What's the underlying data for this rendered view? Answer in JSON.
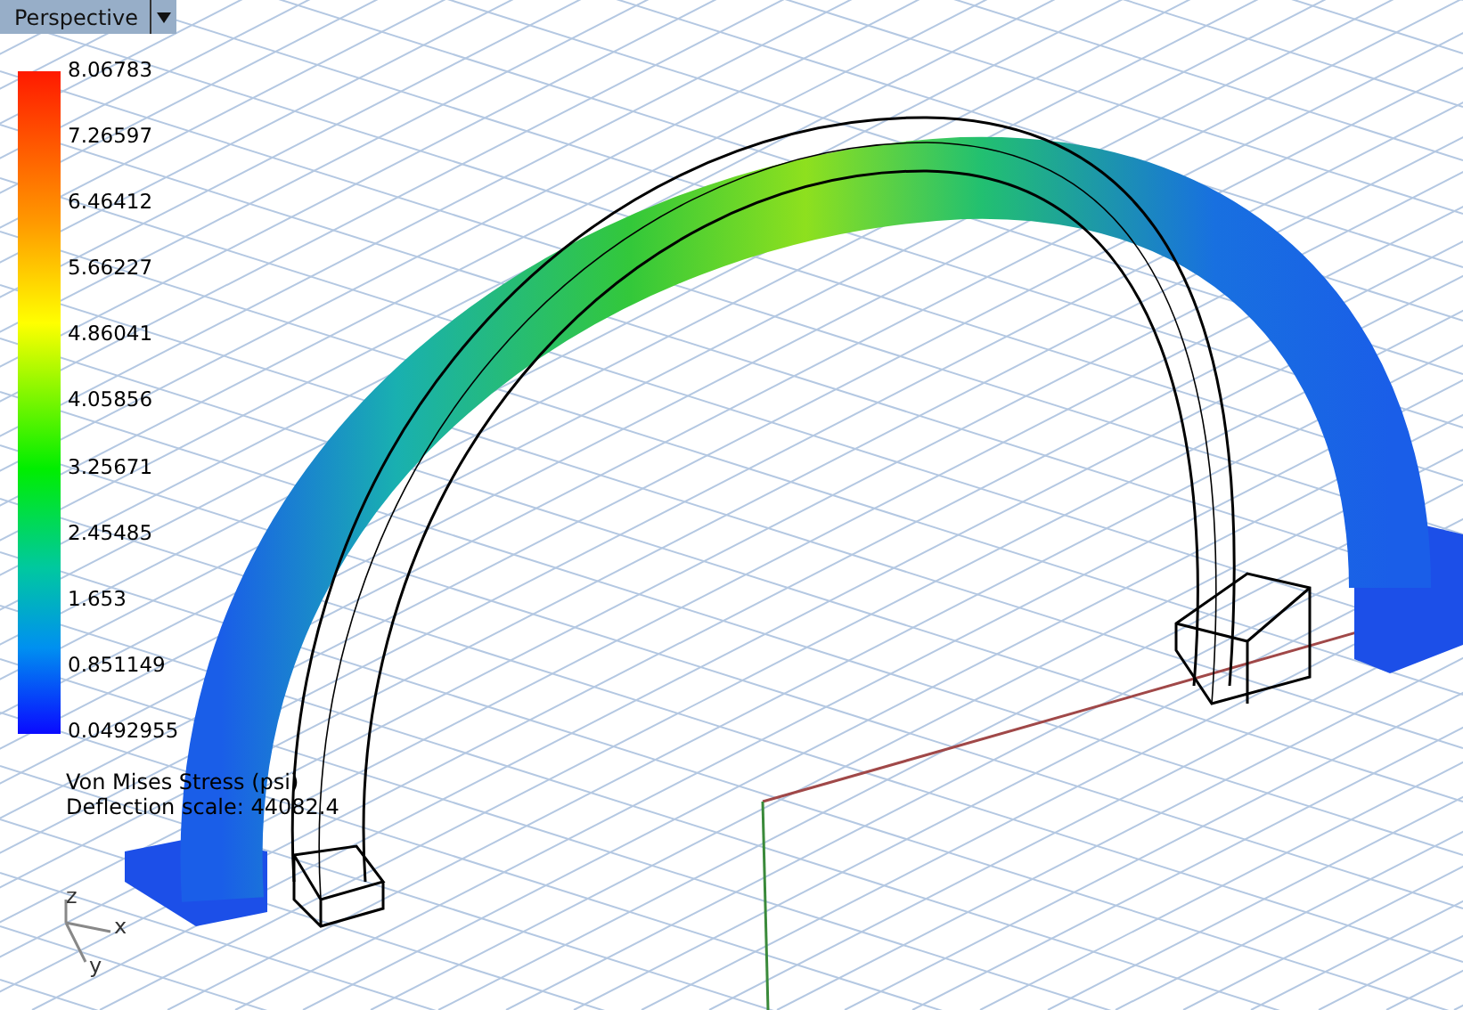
{
  "viewport": {
    "title": "Perspective"
  },
  "legend": {
    "ticks": [
      "8.06783",
      "7.26597",
      "6.46412",
      "5.66227",
      "4.86041",
      "4.05856",
      "3.25671",
      "2.45485",
      "1.653",
      "0.851149",
      "0.0492955"
    ]
  },
  "caption": [
    "Von Mises Stress (psi)",
    "Deflection scale: 44082.4"
  ],
  "axes": {
    "z": "z",
    "x": "x",
    "y": "y"
  }
}
